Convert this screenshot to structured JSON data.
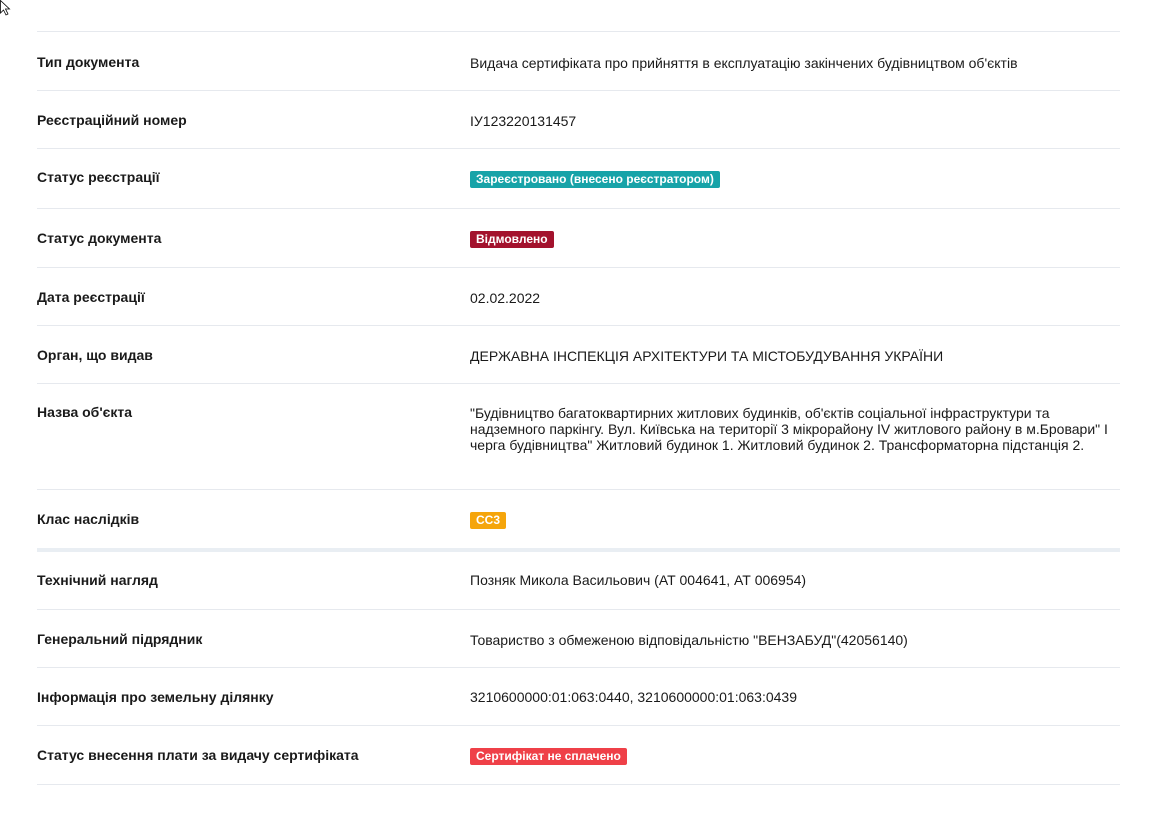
{
  "rows": [
    {
      "label": "Тип документа",
      "value": "Видача сертифіката про прийняття в експлуатацію закінчених будівництвом об'єктів"
    },
    {
      "label": "Реєстраційний номер",
      "value": "IУ123220131457"
    },
    {
      "label": "Статус реєстрації",
      "badge": "Зареєстровано (внесено реєстратором)",
      "badge_color": "#17a3a8"
    },
    {
      "label": "Статус документа",
      "badge": "Відмовлено",
      "badge_color": "#a3122d"
    },
    {
      "label": "Дата реєстрації",
      "value": "02.02.2022"
    },
    {
      "label": "Орган, що видав",
      "value": "ДЕРЖАВНА ІНСПЕКЦІЯ АРХІТЕКТУРИ ТА МІСТОБУДУВАННЯ УКРАЇНИ"
    },
    {
      "label": "Назва об'єкта",
      "value": "\"Будівництво багатоквартирних житлових будинків, об'єктів соціальної інфраструктури та надземного паркінгу. Вул. Київська на території 3 мікрорайону IV житлового району в м.Бровари\" І черга будівництва\" Житловий будинок 1. Житловий будинок 2. Трансформаторна підстанція 2."
    },
    {
      "label": "Клас наслідків",
      "badge": "CC3",
      "badge_color": "#f5a50b"
    },
    {
      "label": "Технічний нагляд",
      "value": "Позняк Микола Васильович (АТ 004641, АТ 006954)"
    },
    {
      "label": "Генеральний підрядник",
      "value": "Товариство з обмеженою відповідальністю \"ВЕНЗАБУД\"(42056140)"
    },
    {
      "label": "Інформація про земельну ділянку",
      "value": "3210600000:01:063:0440, 3210600000:01:063:0439"
    },
    {
      "label": "Статус внесення плати за видачу сертифіката",
      "badge": "Сертифікат не сплачено",
      "badge_color": "#ef4048"
    }
  ]
}
